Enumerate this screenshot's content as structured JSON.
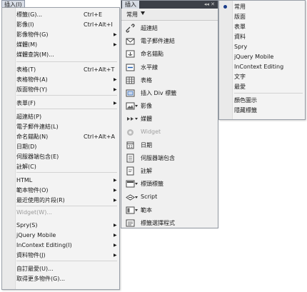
{
  "menubar": {
    "label": "插入(I)"
  },
  "menu": {
    "items": [
      {
        "label": "標籤(G)...",
        "shortcut": "Ctrl+E",
        "sub": false
      },
      {
        "label": "影像(I)",
        "shortcut": "Ctrl+Alt+I",
        "sub": false
      },
      {
        "label": "影像物件(G)",
        "shortcut": "",
        "sub": true
      },
      {
        "label": "媒體(M)",
        "shortcut": "",
        "sub": true
      },
      {
        "label": "媒體查詢(M)...",
        "shortcut": "",
        "sub": false
      },
      {
        "label": "表格(T)",
        "shortcut": "Ctrl+Alt+T",
        "sub": false
      },
      {
        "label": "表格物件(A)",
        "shortcut": "",
        "sub": true
      },
      {
        "label": "版面物件(Y)",
        "shortcut": "",
        "sub": true
      },
      {
        "label": "表單(F)",
        "shortcut": "",
        "sub": true
      },
      {
        "label": "超連結(P)",
        "shortcut": "",
        "sub": false
      },
      {
        "label": "電子郵件連結(L)",
        "shortcut": "",
        "sub": false
      },
      {
        "label": "命名錨點(N)",
        "shortcut": "Ctrl+Alt+A",
        "sub": false
      },
      {
        "label": "日期(D)",
        "shortcut": "",
        "sub": false
      },
      {
        "label": "伺服器端包含(E)",
        "shortcut": "",
        "sub": false
      },
      {
        "label": "註解(C)",
        "shortcut": "",
        "sub": false
      },
      {
        "label": "HTML",
        "shortcut": "",
        "sub": true
      },
      {
        "label": "範本物件(O)",
        "shortcut": "",
        "sub": true
      },
      {
        "label": "最近使用的片段(R)",
        "shortcut": "",
        "sub": true
      },
      {
        "label": "Widget(W)...",
        "shortcut": "",
        "sub": false,
        "disabled": true
      },
      {
        "label": "Spry(S)",
        "shortcut": "",
        "sub": true
      },
      {
        "label": "jQuery Mobile",
        "shortcut": "",
        "sub": true
      },
      {
        "label": "InContext Editing(I)",
        "shortcut": "",
        "sub": true
      },
      {
        "label": "資料物件(J)",
        "shortcut": "",
        "sub": true
      },
      {
        "label": "自訂最愛(U)...",
        "shortcut": "",
        "sub": false
      },
      {
        "label": "取得更多物件(G)...",
        "shortcut": "",
        "sub": false
      }
    ]
  },
  "panel": {
    "tab": "插入",
    "ctrl": "◂◂ ✕",
    "category": "常用",
    "items": [
      {
        "label": "超連結",
        "icon": "hyperlink-icon",
        "dd": false
      },
      {
        "label": "電子郵件連結",
        "icon": "email-icon",
        "dd": false
      },
      {
        "label": "命名錨點",
        "icon": "anchor-icon",
        "dd": false
      },
      {
        "label": "水平線",
        "icon": "horizontal-rule-icon",
        "dd": false
      },
      {
        "label": "表格",
        "icon": "table-icon",
        "dd": false
      },
      {
        "label": "插入 Div 標籤",
        "icon": "div-icon",
        "dd": false
      },
      {
        "label": "影像",
        "icon": "image-icon",
        "dd": true
      },
      {
        "label": "媒體",
        "icon": "media-icon",
        "dd": true
      },
      {
        "label": "Widget",
        "icon": "widget-icon",
        "dd": false,
        "gray": true
      },
      {
        "label": "日期",
        "icon": "date-icon",
        "dd": false
      },
      {
        "label": "伺服器端包含",
        "icon": "server-include-icon",
        "dd": false
      },
      {
        "label": "註解",
        "icon": "comment-icon",
        "dd": false
      },
      {
        "label": "標頭標籤",
        "icon": "head-tag-icon",
        "dd": true
      },
      {
        "label": "Script",
        "icon": "script-icon",
        "dd": true
      },
      {
        "label": "範本",
        "icon": "template-icon",
        "dd": true
      },
      {
        "label": "標籤選擇程式",
        "icon": "tag-chooser-icon",
        "dd": false
      }
    ]
  },
  "rmenu": {
    "items": [
      {
        "label": "常用",
        "checked": true
      },
      {
        "label": "版面"
      },
      {
        "label": "表單"
      },
      {
        "label": "資料"
      },
      {
        "label": "Spry"
      },
      {
        "label": "jQuery Mobile"
      },
      {
        "label": "InContext Editing"
      },
      {
        "label": "文字"
      },
      {
        "label": "最愛"
      },
      {
        "label": "顏色圖示"
      },
      {
        "label": "隱藏標籤"
      }
    ]
  }
}
